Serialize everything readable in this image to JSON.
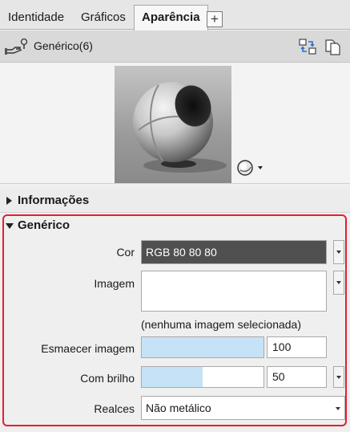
{
  "tabs": [
    {
      "label": "Identidade"
    },
    {
      "label": "Gráficos"
    },
    {
      "label": "Aparência",
      "active": true
    }
  ],
  "tab_add_label": "+",
  "material": {
    "name": "Genérico(6)",
    "icons": [
      "material-hand-icon",
      "replace-material-icon",
      "duplicate-material-icon"
    ]
  },
  "preview": {
    "image": "sphere-material-preview",
    "menu_icon": "sphere-options-icon"
  },
  "sections": {
    "info": {
      "label": "Informações",
      "expanded": false
    },
    "generic": {
      "label": "Genérico",
      "expanded": true
    }
  },
  "properties": {
    "color": {
      "label": "Cor",
      "value": "RGB 80 80 80",
      "swatch": "#505050"
    },
    "image": {
      "label": "Imagem",
      "note": "(nenhuma imagem selecionada)"
    },
    "fade": {
      "label": "Esmaecer imagem",
      "value": "100",
      "level": 1.0
    },
    "gloss": {
      "label": "Com brilho",
      "value": "50",
      "level": 0.5
    },
    "highlights": {
      "label": "Realces",
      "value": "Não metálico"
    }
  },
  "colors": {
    "highlight_border": "#e2202f",
    "slider_fill": "#c6e2f6"
  }
}
